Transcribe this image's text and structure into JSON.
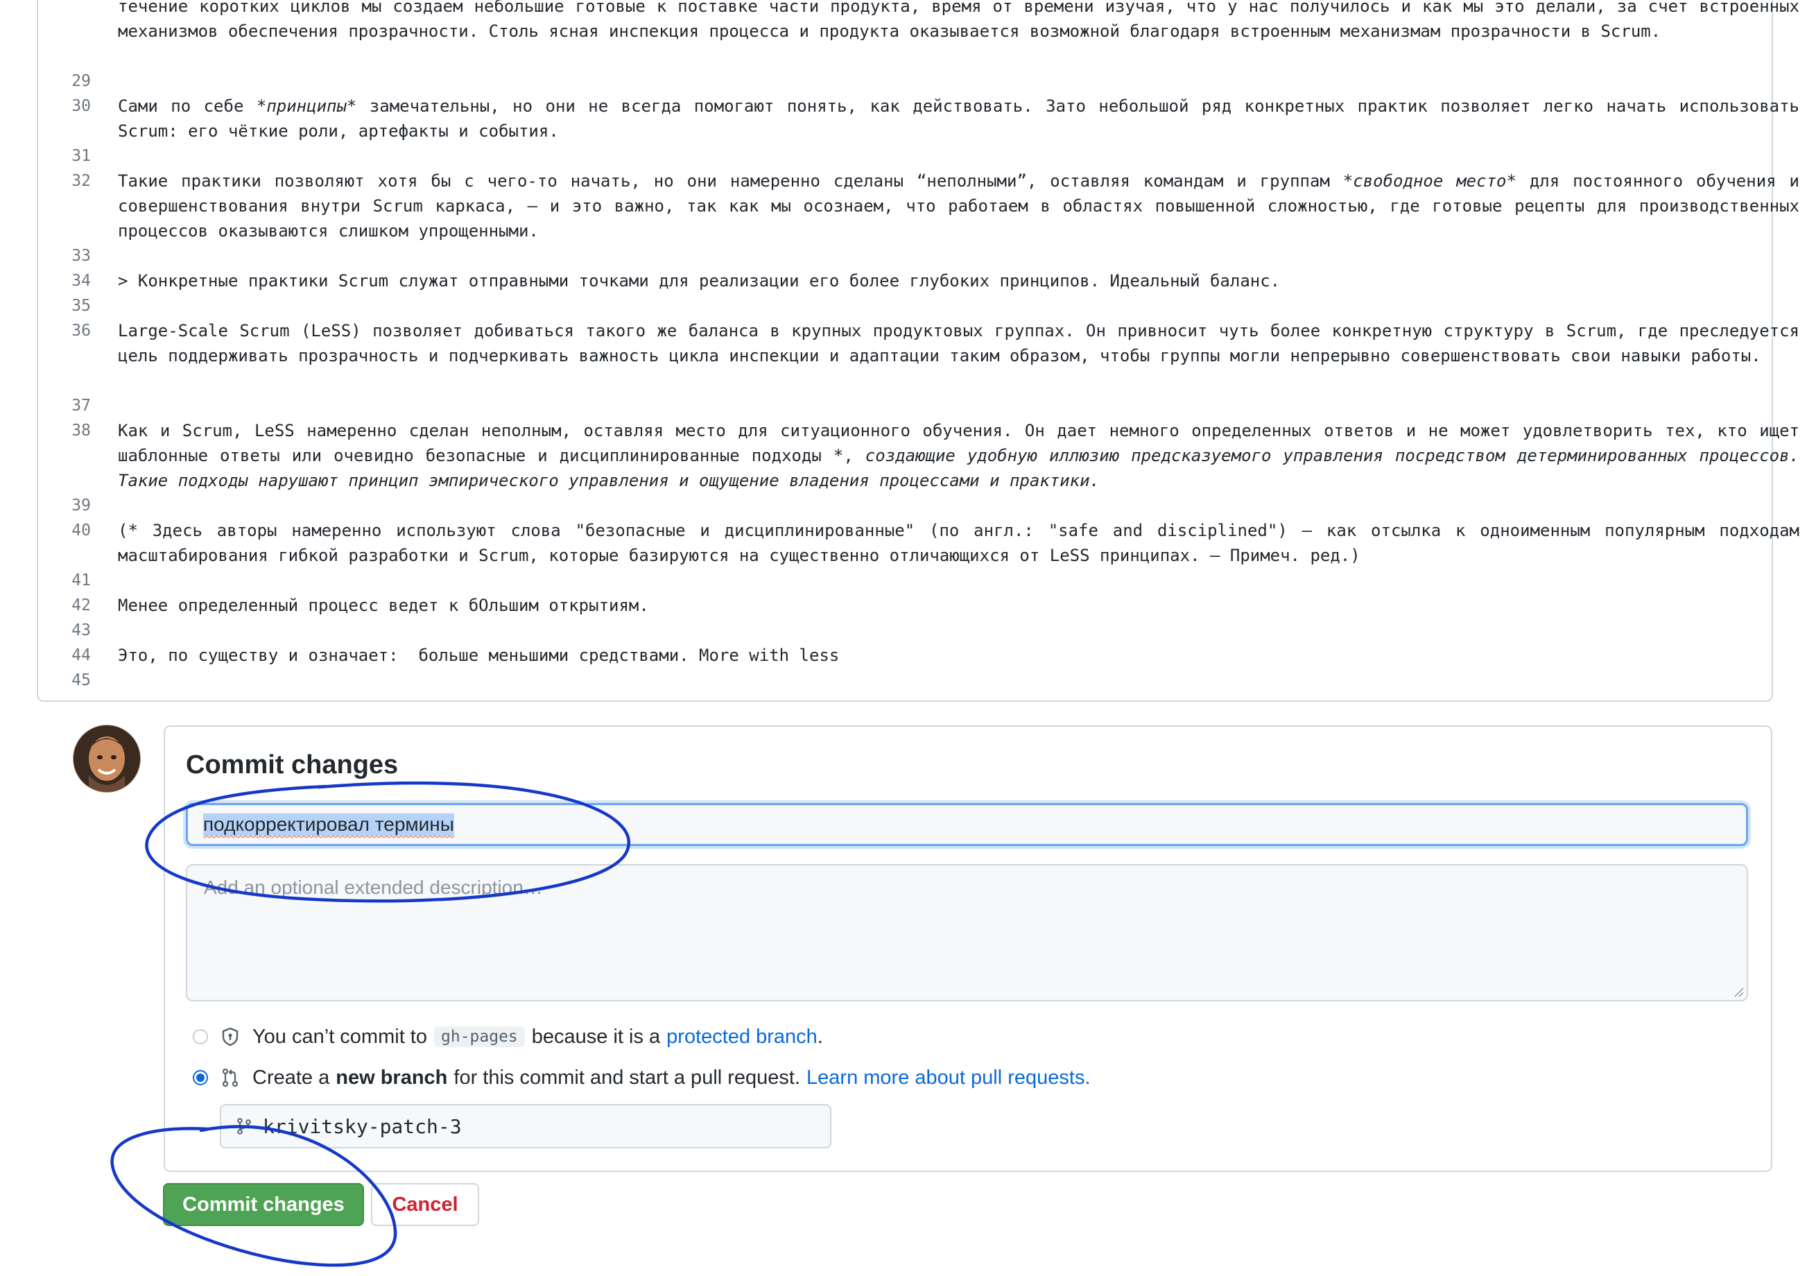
{
  "editor": {
    "lines": [
      {
        "num": "",
        "segments": [
          {
            "text": "течение коротких циклов мы создаем небольшие готовые к поставке части продукта, время от времени изучая, что у нас получилось и как мы это делали, за счет встроенных механизмов обеспечения прозрачности. Столь ясная инспекция процесса и продукта оказывается возможной благодаря встроенным механизмам прозрачности в Scrum.",
            "italic": false
          }
        ]
      },
      {
        "num": "29",
        "segments": [
          {
            "text": "",
            "italic": false
          }
        ]
      },
      {
        "num": "30",
        "segments": [
          {
            "text": "Сами по себе ",
            "italic": false
          },
          {
            "text": "*принципы*",
            "italic": true
          },
          {
            "text": " замечательны, но они не всегда помогают понять, как действовать. Зато небольшой ряд конкретных практик позволяет легко начать использовать Scrum: его чёткие роли, артефакты и события.",
            "italic": false
          }
        ]
      },
      {
        "num": "31",
        "segments": [
          {
            "text": "",
            "italic": false
          }
        ]
      },
      {
        "num": "32",
        "segments": [
          {
            "text": "Такие практики позволяют хотя бы с чего-то начать, но они намеренно сделаны “неполными”, оставляя командам и группам ",
            "italic": false
          },
          {
            "text": "*свободное место*",
            "italic": true
          },
          {
            "text": " для постоянного обучения и совершенствования внутри Scrum каркаса, – и это важно, так как мы осознаем, что работаем в областях повышенной сложностью, где готовые рецепты для производственных процессов оказываются слишком упрощенными.",
            "italic": false
          }
        ]
      },
      {
        "num": "33",
        "segments": [
          {
            "text": "",
            "italic": false
          }
        ]
      },
      {
        "num": "34",
        "segments": [
          {
            "text": "> Конкретные практики Scrum служат отправными точками для реализации его более глубоких принципов. Идеальный баланс.",
            "italic": false
          }
        ]
      },
      {
        "num": "35",
        "segments": [
          {
            "text": "",
            "italic": false
          }
        ]
      },
      {
        "num": "36",
        "segments": [
          {
            "text": "Large-Scale Scrum (LeSS) позволяет добиваться такого же баланса в крупных продуктовых группах. Он привносит чуть более конкретную структуру в Scrum, где преследуется цель поддерживать прозрачность и подчеркивать важность цикла инспекции и адаптации таким образом, чтобы группы могли непрерывно совершенствовать свои навыки работы.",
            "italic": false
          }
        ]
      },
      {
        "num": "37",
        "segments": [
          {
            "text": "",
            "italic": false
          }
        ]
      },
      {
        "num": "38",
        "segments": [
          {
            "text": "Как и Scrum, LeSS намеренно сделан неполным, оставляя место для ситуационного обучения. Он дает немного определенных ответов и не может удовлетворить тех, кто ищет шаблонные ответы или очевидно безопасные и дисциплинированные подходы *, ",
            "italic": false
          },
          {
            "text": "создающие удобную иллюзию предсказуемого управления посредством детерминированных процессов. Такие подходы нарушают принцип эмпирического управления и ощущение владения процессами и практики.",
            "italic": true
          }
        ]
      },
      {
        "num": "39",
        "segments": [
          {
            "text": "",
            "italic": false
          }
        ]
      },
      {
        "num": "40",
        "segments": [
          {
            "text": "(* Здесь авторы намеренно используют слова \"безопасные и дисциплинированные\" (по англ.: \"safe and disciplined\") – как отсылка к одноименным популярным подходам масштабирования гибкой разработки и Scrum, которые базируются на существенно отличающихся от LeSS принципах. – Примеч. ред.)",
            "italic": false
          }
        ]
      },
      {
        "num": "41",
        "segments": [
          {
            "text": "",
            "italic": false
          }
        ]
      },
      {
        "num": "42",
        "segments": [
          {
            "text": "Менее определенный процесс ведет к бОльшим открытиям.",
            "italic": false
          }
        ]
      },
      {
        "num": "43",
        "segments": [
          {
            "text": "",
            "italic": false
          }
        ]
      },
      {
        "num": "44",
        "segments": [
          {
            "text": "Это, по существу и означает:  больше меньшими средствами. More with less",
            "italic": false
          }
        ]
      },
      {
        "num": "45",
        "segments": [
          {
            "text": "",
            "italic": false
          }
        ]
      }
    ]
  },
  "commit": {
    "title": "Commit changes",
    "summary_value": "подкорректировал термины",
    "description_placeholder": "Add an optional extended description…",
    "option_protected": {
      "prefix": "You can’t commit to",
      "branch_pill": "gh-pages",
      "middle": "because it is a",
      "link": "protected branch",
      "suffix": ".",
      "selected": false
    },
    "option_new_branch": {
      "prefix": "Create a",
      "bold": "new branch",
      "middle": "for this commit and start a pull request.",
      "link": "Learn more about pull requests.",
      "selected": true
    },
    "branch_name": "krivitsky-patch-3",
    "commit_button": "Commit changes",
    "cancel_button": "Cancel"
  },
  "colors": {
    "accent_blue": "#0969da",
    "commit_green": "#4fa355",
    "cancel_red": "#cf222e",
    "annotation_blue": "#1538c9"
  },
  "icons": {
    "protected_option": "shield-lock-icon",
    "new_branch_option": "git-pull-request-icon",
    "branch_field": "git-branch-icon"
  }
}
